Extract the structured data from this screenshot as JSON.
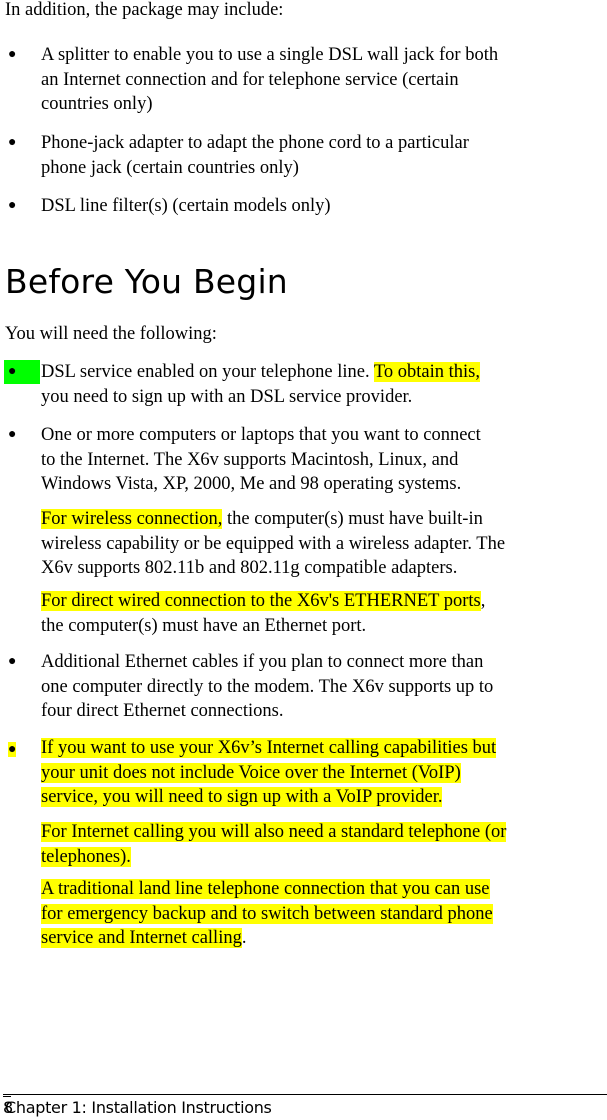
{
  "intro": "In addition, the package may include:",
  "package_items": [
    [
      "A splitter to enable you to use a single DSL wall jack for both",
      "an Internet connection and for telephone service (certain",
      "countries only)"
    ],
    [
      "Phone-jack adapter to adapt the phone cord to a particular",
      "phone jack (certain countries only)"
    ],
    [
      "DSL line filter(s) (certain models only)"
    ]
  ],
  "heading": "Before You Begin",
  "lead": "You will need the following:",
  "req1": {
    "a": "DSL service enabled on your telephone line. ",
    "hl": "To obtain this,",
    "line2": "you need to sign up with an DSL service provider."
  },
  "req2": {
    "lines": [
      "One or more computers or laptops that you want to connect",
      "to the Internet. The X6v supports Macintosh, Linux, and",
      "Windows Vista, XP, 2000, Me and 98 operating systems."
    ],
    "wireless_hl": "For wireless connection,",
    "wireless_rest": " the computer(s) must have built-in",
    "wireless_lines": [
      "wireless capability or be equipped with a wireless adapter. The",
      "X6v supports 802.11b and 802.11g compatible adapters."
    ],
    "wired_hl": "For direct wired connection to the X6v's ETHERNET ports",
    "wired_rest": ",",
    "wired_line2": "the computer(s) must have an Ethernet port."
  },
  "req3": [
    "Additional Ethernet cables if you plan to connect more than",
    "one computer directly to the modem. The X6v supports up to",
    "four direct Ethernet connections."
  ],
  "req4": {
    "lines": [
      "If you want to use your X6v’s Internet calling capabilities but",
      "your unit does not include Voice over the Internet (VoIP)",
      "service, you will need to sign up with a VoIP provider."
    ],
    "phone_lines": [
      "For Internet calling you will also need a standard telephone (or",
      "telephones)."
    ],
    "landline_lines": [
      "A traditional land line telephone connection that you can use",
      "for emergency backup and to switch between standard phone",
      "service and Internet calling"
    ],
    "landline_end": "."
  },
  "footer": {
    "page_number": "8",
    "chapter": "Chapter 1: Installation Instructions"
  },
  "colors": {
    "highlight": "#ffff00",
    "bullet_highlight": "#00ff00"
  }
}
